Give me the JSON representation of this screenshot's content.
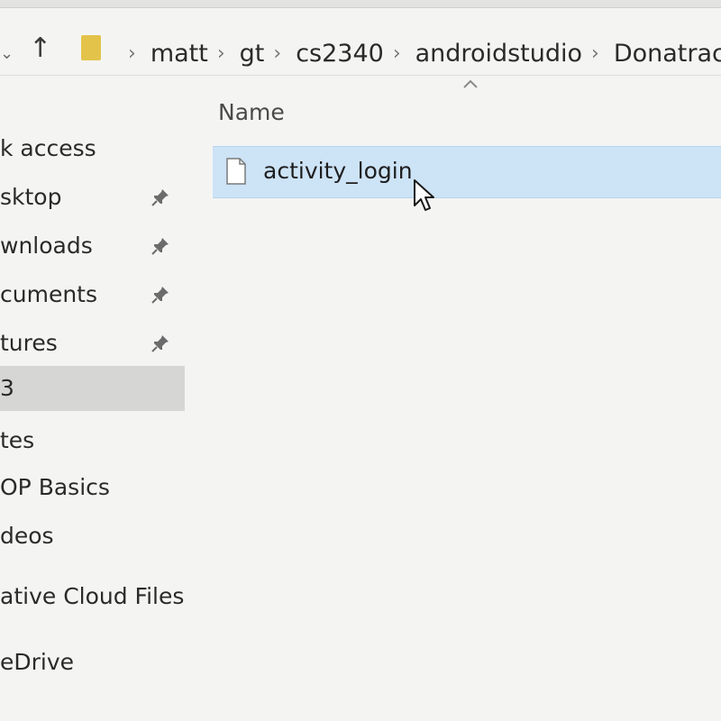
{
  "breadcrumb": {
    "items": [
      "matt",
      "gt",
      "cs2340",
      "androidstudio",
      "Donatrac"
    ]
  },
  "sidebar": {
    "items": [
      {
        "label": "k access",
        "pinned": false
      },
      {
        "label": "sktop",
        "pinned": true
      },
      {
        "label": "wnloads",
        "pinned": true
      },
      {
        "label": "cuments",
        "pinned": true
      },
      {
        "label": "tures",
        "pinned": true
      },
      {
        "label": "3",
        "pinned": false,
        "selected": true
      },
      {
        "label": "tes",
        "pinned": false
      },
      {
        "label": "OP Basics",
        "pinned": false
      },
      {
        "label": "deos",
        "pinned": false
      },
      {
        "label": "ative Cloud Files",
        "pinned": false
      },
      {
        "label": "eDrive",
        "pinned": false
      }
    ]
  },
  "file_list": {
    "column_header": "Name",
    "files": [
      {
        "name": "activity_login",
        "icon": "file-icon",
        "selected": true
      }
    ]
  },
  "colors": {
    "selection": "#cde3f6",
    "sidebar_selected": "#d6d6d4",
    "folder": "#e3c34a"
  }
}
